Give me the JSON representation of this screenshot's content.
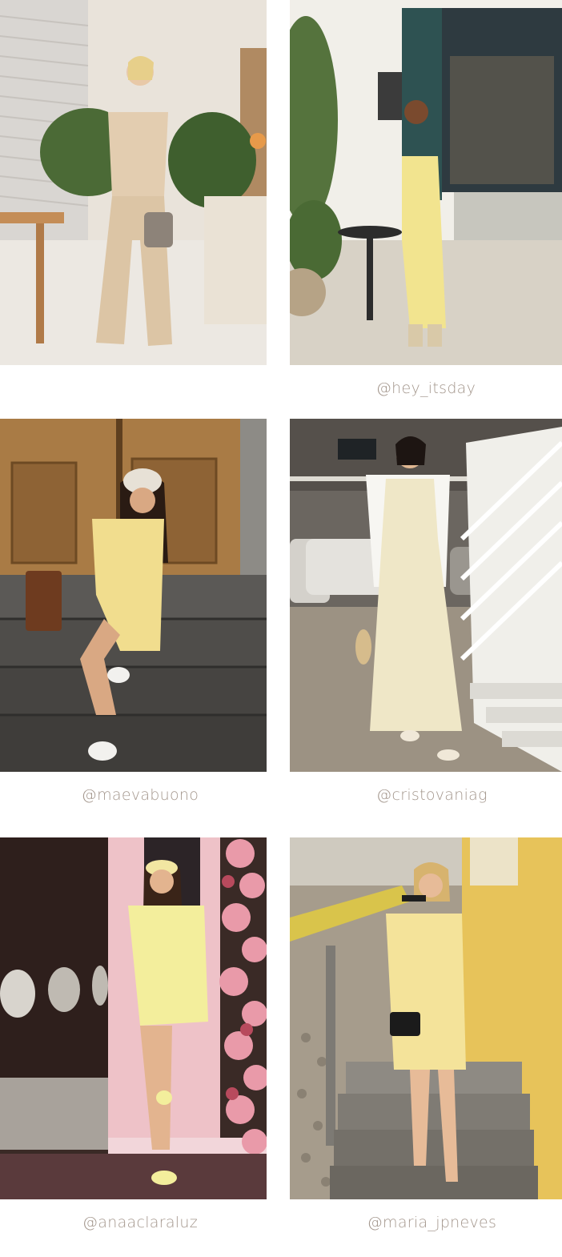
{
  "gallery": {
    "items": [
      {
        "handle": ""
      },
      {
        "handle": "@hey_itsday"
      },
      {
        "handle": "@maevabuono"
      },
      {
        "handle": "@cristovaniag"
      },
      {
        "handle": "@anaaclaraluz"
      },
      {
        "handle": "@maria_jpneves"
      }
    ]
  },
  "colors": {
    "caption": "#a3968c",
    "background": "#ffffff"
  }
}
